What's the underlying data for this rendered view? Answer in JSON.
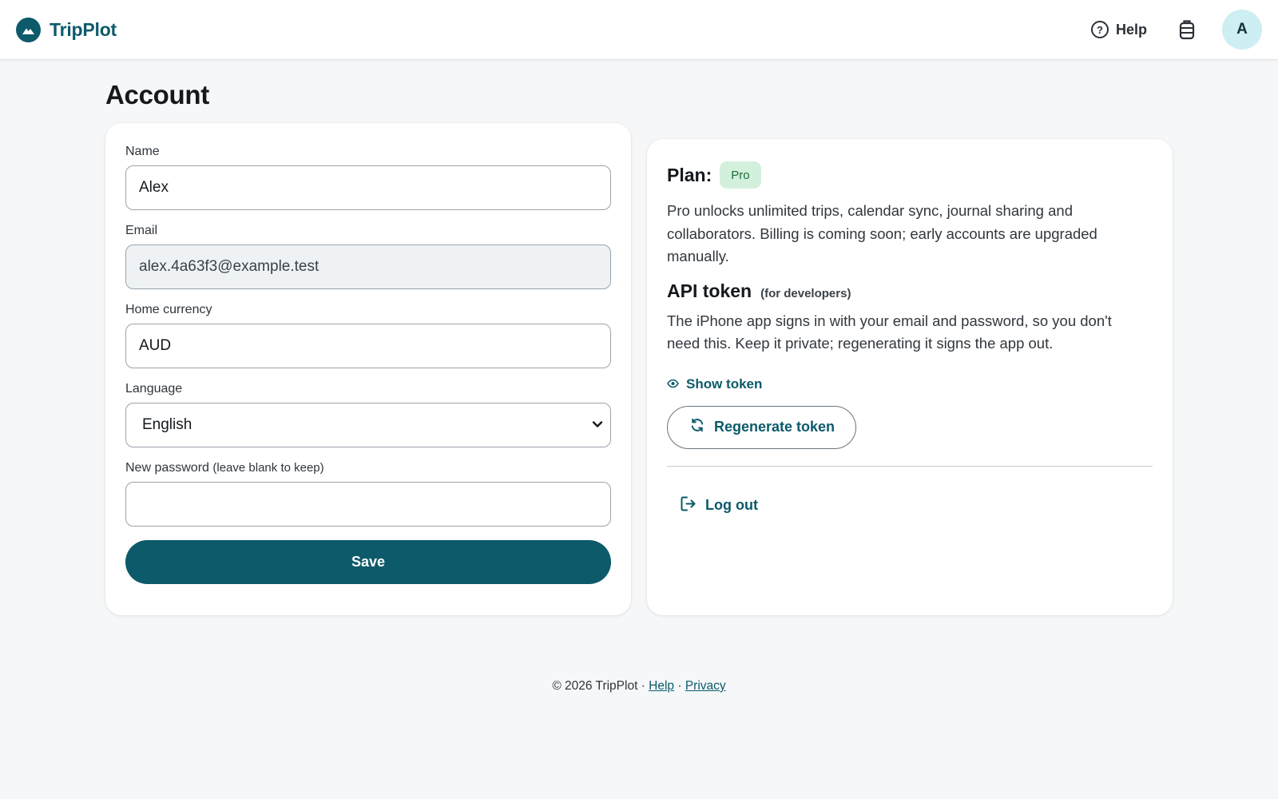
{
  "header": {
    "brand": "TripPlot",
    "help_label": "Help",
    "avatar_initial": "A"
  },
  "page": {
    "title": "Account"
  },
  "form": {
    "name_label": "Name",
    "name_value": "Alex",
    "email_label": "Email",
    "email_value": "alex.4a63f3@example.test",
    "currency_label": "Home currency",
    "currency_value": "AUD",
    "language_label": "Language",
    "language_value": "English",
    "password_label": "New password",
    "password_hint": "(leave blank to keep)",
    "password_value": "",
    "save_label": "Save"
  },
  "plan": {
    "title": "Plan:",
    "badge": "Pro",
    "description": "Pro unlocks unlimited trips, calendar sync, journal sharing and collaborators. Billing is coming soon; early accounts are upgraded manually.",
    "api_title": "API token",
    "api_subtitle": "(for developers)",
    "api_description": "The iPhone app signs in with your email and password, so you don't need this. Keep it private; regenerating it signs the app out.",
    "show_token_label": "Show token",
    "regenerate_label": "Regenerate token",
    "logout_label": "Log out"
  },
  "footer": {
    "copyright": "© 2026 TripPlot ·",
    "help_link": "Help",
    "separator": "·",
    "privacy_link": "Privacy"
  },
  "colors": {
    "brand": "#0c5a6a",
    "badge_bg": "#d3f0dc",
    "avatar_bg": "#cdeef2",
    "page_bg": "#f5f7f8"
  },
  "icons": {
    "logo": "mountain-logo-icon",
    "help": "help-circle-icon",
    "bag": "luggage-icon",
    "eye": "eye-icon",
    "refresh": "refresh-icon",
    "logout": "logout-icon",
    "chevron": "chevron-down-icon"
  }
}
